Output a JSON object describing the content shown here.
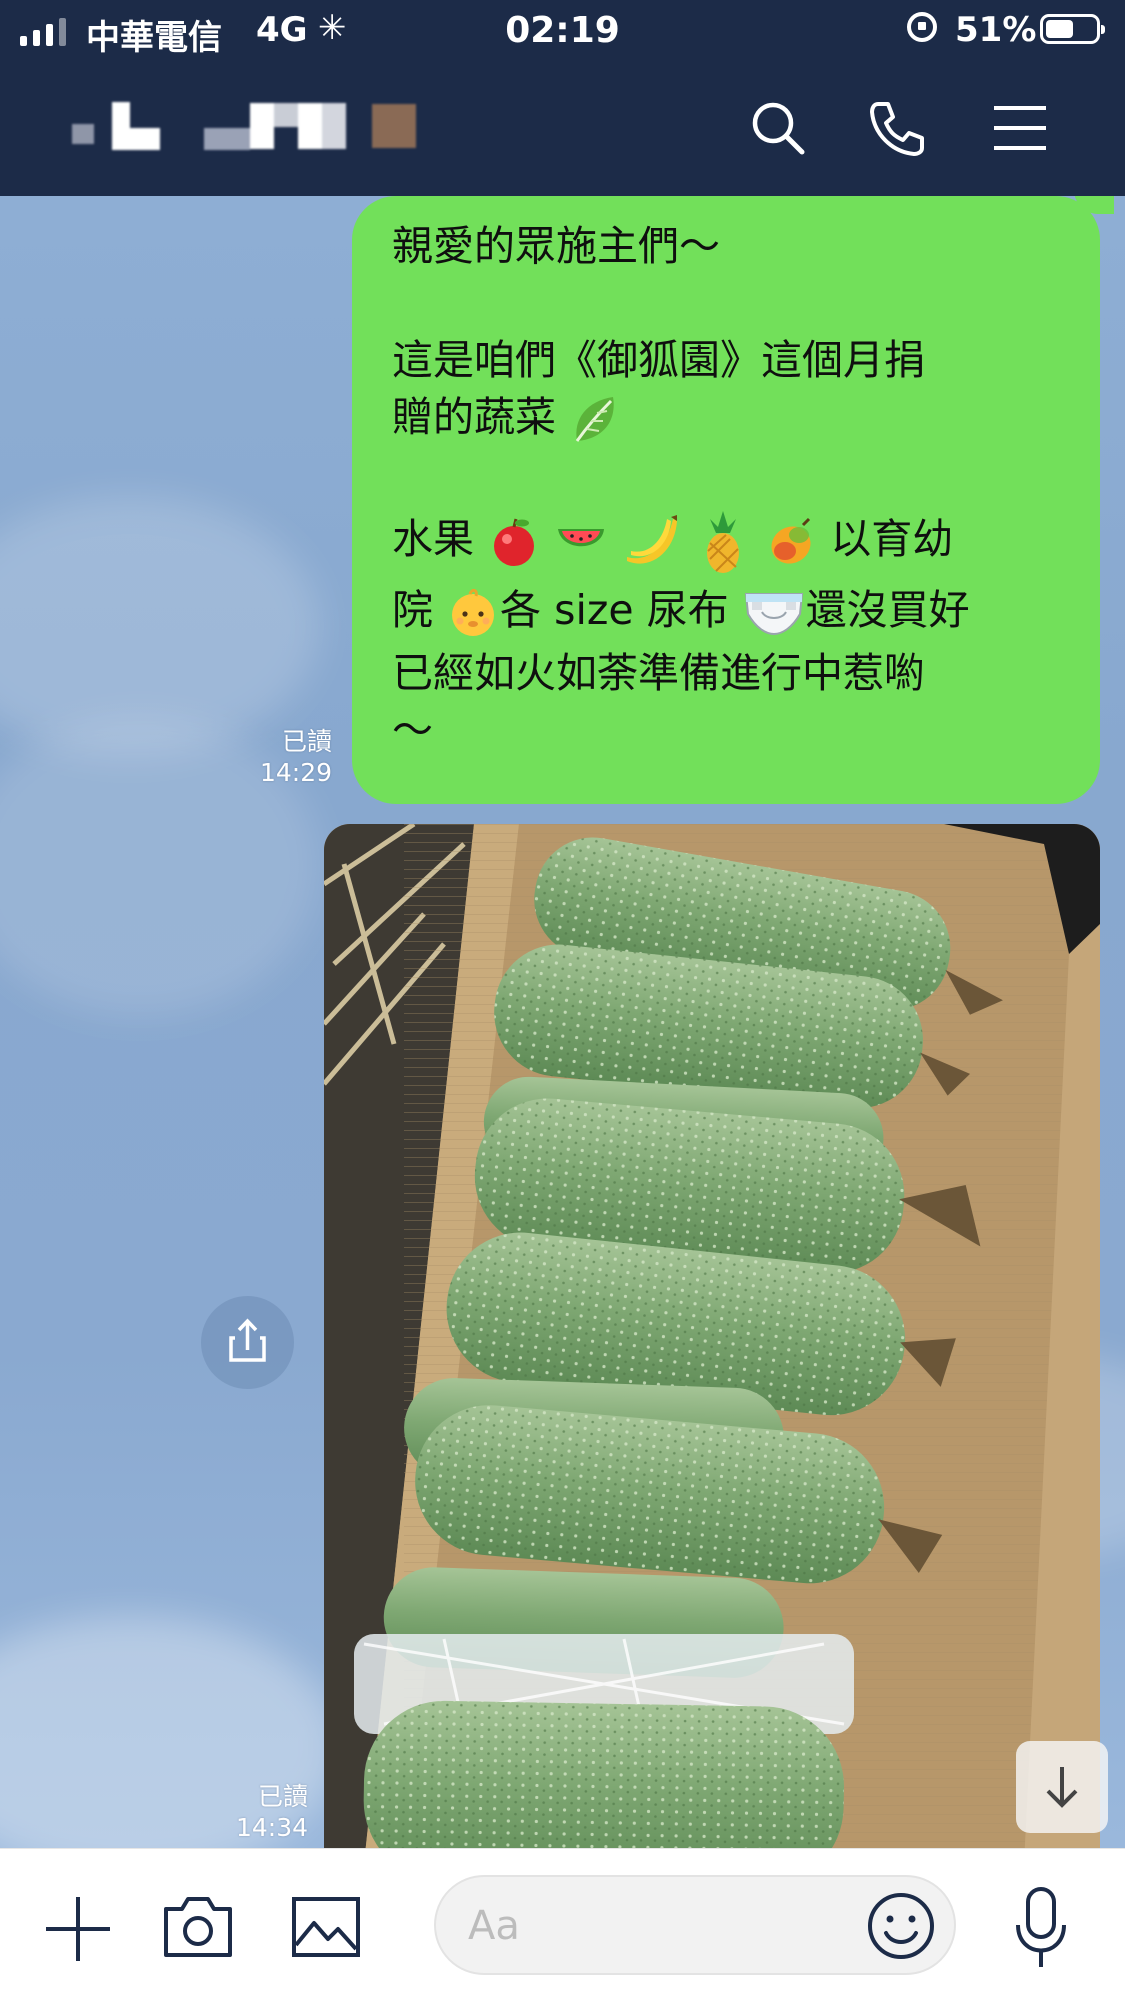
{
  "status_bar": {
    "carrier": "中華電信",
    "network": "4G",
    "time": "02:19",
    "battery": "51%"
  },
  "header": {
    "contact_name": "",
    "icons": [
      "search-icon",
      "phone-icon",
      "menu-icon"
    ]
  },
  "messages": [
    {
      "type": "text",
      "lines": [
        "親愛的眾施主們～",
        "",
        "這是咱們《御狐園》這個月捐",
        "贈的蔬菜",
        "",
        "水果",
        "以育幼",
        "院",
        "各 size 尿布",
        "還沒買好",
        "已經如火如荼準備進行中惹喲",
        "～"
      ],
      "read_label": "已讀",
      "time": "14:29"
    },
    {
      "type": "image",
      "description_icon": "photo-loofah-box",
      "read_label": "已讀",
      "time": "14:34"
    }
  ],
  "input_bar": {
    "placeholder": "Aa",
    "icons": [
      "plus-icon",
      "camera-icon",
      "image-icon",
      "emoji-icon",
      "mic-icon"
    ]
  },
  "colors": {
    "header_bg": "#1c2b48",
    "bubble_bg": "#72e05a",
    "chat_bg": "#8eaed4"
  }
}
